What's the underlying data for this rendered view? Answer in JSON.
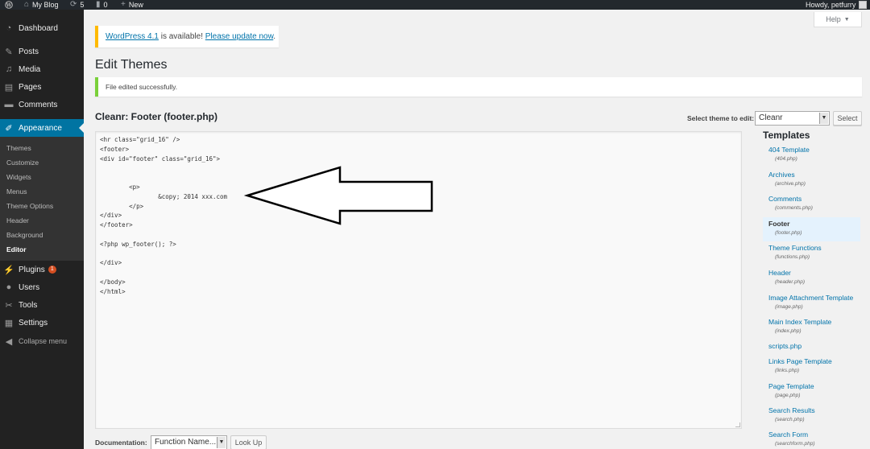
{
  "adminbar": {
    "site_name": "My Blog",
    "updates_count": "5",
    "comments_count": "0",
    "new_label": "New",
    "greeting": "Howdy, petfurry"
  },
  "help_tab": {
    "label": "Help"
  },
  "sidebar": {
    "items": [
      {
        "label": "Dashboard",
        "icon": "dashboard-icon"
      },
      {
        "label": "Posts",
        "icon": "pin-icon"
      },
      {
        "label": "Media",
        "icon": "media-icon"
      },
      {
        "label": "Pages",
        "icon": "pages-icon"
      },
      {
        "label": "Comments",
        "icon": "comment-icon"
      },
      {
        "label": "Appearance",
        "icon": "brush-icon"
      },
      {
        "label": "Plugins",
        "icon": "plug-icon",
        "badge": "1"
      },
      {
        "label": "Users",
        "icon": "user-icon"
      },
      {
        "label": "Tools",
        "icon": "wrench-icon"
      },
      {
        "label": "Settings",
        "icon": "settings-icon"
      },
      {
        "label": "Collapse menu",
        "icon": "collapse-icon"
      }
    ],
    "appearance_submenu": [
      "Themes",
      "Customize",
      "Widgets",
      "Menus",
      "Theme Options",
      "Header",
      "Background",
      "Editor"
    ]
  },
  "notices": {
    "update_link": "WordPress 4.1",
    "update_text": " is available! ",
    "update_action": "Please update now",
    "update_end": ".",
    "success": "File edited successfully."
  },
  "page": {
    "title": "Edit Themes",
    "file_title": "Cleanr: Footer (footer.php)",
    "select_theme_label": "Select theme to edit:",
    "selected_theme": "Cleanr",
    "select_button": "Select"
  },
  "editor": {
    "code": "<hr class=\"grid_16\" />\n<footer>\n<div id=\"footer\" class=\"grid_16\">\n\n\n        <p>\n                &copy; 2014 xxx.com\n        </p>\n</div>\n</footer>\n\n<?php wp_footer(); ?>\n\n</div>\n\n</body>\n</html>"
  },
  "templates": {
    "heading": "Templates",
    "items": [
      {
        "name": "404 Template",
        "file": "(404.php)"
      },
      {
        "name": "Archives",
        "file": "(archive.php)"
      },
      {
        "name": "Comments",
        "file": "(comments.php)"
      },
      {
        "name": "Footer",
        "file": "(footer.php)",
        "current": true
      },
      {
        "name": "Theme Functions",
        "file": "(functions.php)"
      },
      {
        "name": "Header",
        "file": "(header.php)"
      },
      {
        "name": "Image Attachment Template",
        "file": "(image.php)"
      },
      {
        "name": "Main Index Template",
        "file": "(index.php)"
      },
      {
        "name": "scripts.php",
        "file": ""
      },
      {
        "name": "Links Page Template",
        "file": "(links.php)"
      },
      {
        "name": "Page Template",
        "file": "(page.php)"
      },
      {
        "name": "Search Results",
        "file": "(search.php)"
      },
      {
        "name": "Search Form",
        "file": "(searchform.php)"
      }
    ]
  },
  "documentation": {
    "label": "Documentation:",
    "selected": "Function Name...",
    "lookup_button": "Look Up"
  },
  "colors": {
    "adminbar_bg": "#23282d",
    "sidebar_bg": "#222222",
    "accent": "#0074a2",
    "update_notice": "#ffba00",
    "success_notice": "#7ad03a",
    "plugin_badge": "#d54e21"
  }
}
